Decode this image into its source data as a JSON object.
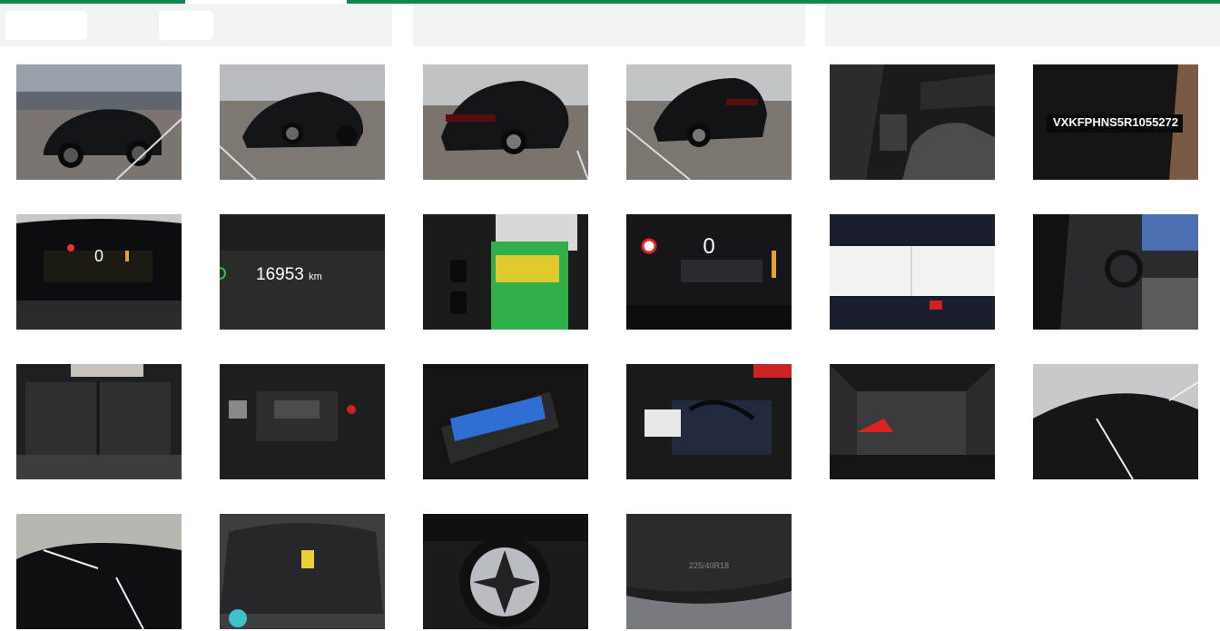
{
  "header": {
    "accent_color": "#0a8a4f",
    "panel_color": "#f3f3f3"
  },
  "gallery": {
    "photos": [
      {
        "id": 1,
        "subject": "car-front-left"
      },
      {
        "id": 2,
        "subject": "car-front-left-2"
      },
      {
        "id": 3,
        "subject": "car-rear-left"
      },
      {
        "id": 4,
        "subject": "car-rear-right"
      },
      {
        "id": 5,
        "subject": "interior-front-seats"
      },
      {
        "id": 6,
        "subject": "vin-plate",
        "text": "VXKFPHNS5R1055272"
      },
      {
        "id": 7,
        "subject": "instrument-cluster",
        "text": "0"
      },
      {
        "id": 8,
        "subject": "odometer",
        "value": "16953",
        "unit": "km"
      },
      {
        "id": 9,
        "subject": "keys-and-manual"
      },
      {
        "id": 10,
        "subject": "dashboard-display",
        "text": "0"
      },
      {
        "id": 11,
        "subject": "service-documents"
      },
      {
        "id": 12,
        "subject": "interior-dashboard"
      },
      {
        "id": 13,
        "subject": "rear-seats"
      },
      {
        "id": 14,
        "subject": "engine-bay"
      },
      {
        "id": 15,
        "subject": "trunk-bag"
      },
      {
        "id": 16,
        "subject": "charging-cables"
      },
      {
        "id": 17,
        "subject": "trunk-open"
      },
      {
        "id": 18,
        "subject": "hood-paint"
      },
      {
        "id": 19,
        "subject": "roof-paint"
      },
      {
        "id": 20,
        "subject": "windshield"
      },
      {
        "id": 21,
        "subject": "alloy-wheel"
      },
      {
        "id": 22,
        "subject": "tire-sidewall",
        "text": "225/40R18"
      }
    ]
  }
}
